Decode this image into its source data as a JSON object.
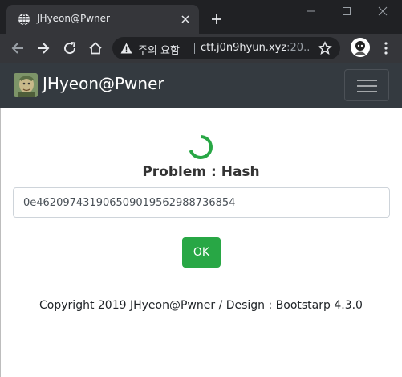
{
  "browser": {
    "tab_title": "JHyeon@Pwner",
    "security_warning": "주의 요함",
    "url_host": "ctf.j0n9hyun.xyz",
    "url_rest": ":20...",
    "icons": {
      "favicon": "globe-icon",
      "tab_close": "close-icon",
      "new_tab": "plus-icon",
      "back": "arrow-left-icon",
      "forward": "arrow-right-icon",
      "reload": "reload-icon",
      "home": "home-icon",
      "warning": "warning-icon",
      "bookmark": "star-icon"
    }
  },
  "navbar": {
    "brand": "JHyeon@Pwner",
    "background": "#343a40"
  },
  "main": {
    "title": "Problem : Hash",
    "hash_value": "0e462097431906509019562988736854",
    "ok_label": "OK",
    "spinner_color": "#28a745",
    "button_color": "#28a745"
  },
  "footer": {
    "copyright": "Copyright 2019 JHyeon@Pwner / Design : Bootstarp 4.3.0"
  }
}
